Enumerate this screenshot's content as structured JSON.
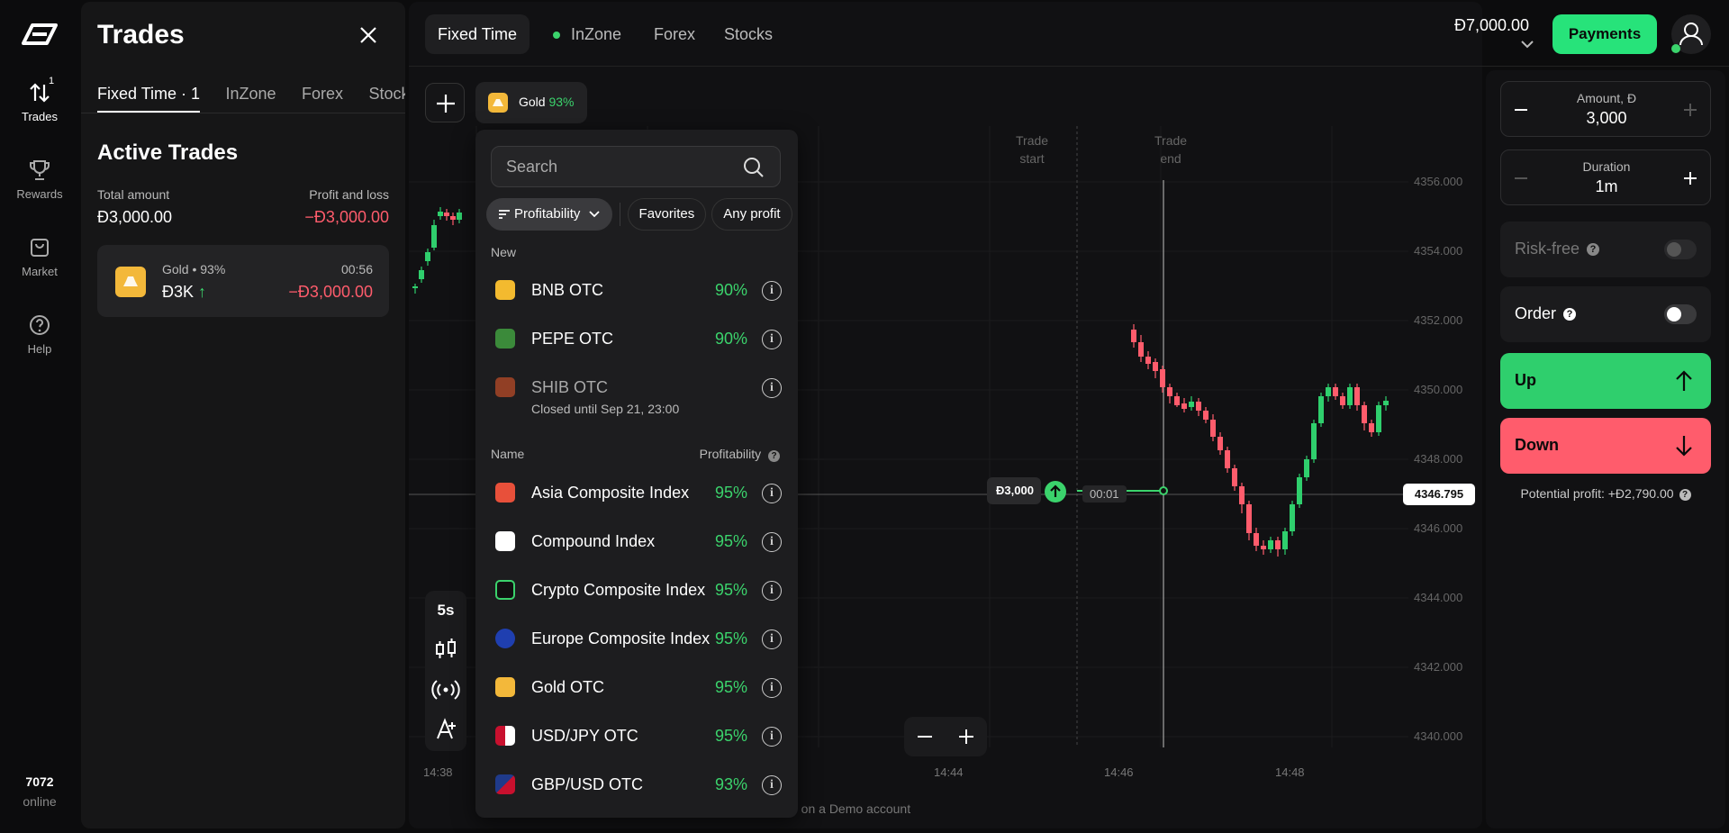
{
  "nav": {
    "items": [
      {
        "label": "Trades",
        "badge": "1"
      },
      {
        "label": "Rewards"
      },
      {
        "label": "Market"
      },
      {
        "label": "Help"
      }
    ],
    "online_count": "7072",
    "online_label": "online"
  },
  "trades_panel": {
    "title": "Trades",
    "tabs": [
      {
        "label": "Fixed Time · 1"
      },
      {
        "label": "InZone"
      },
      {
        "label": "Forex"
      },
      {
        "label": "Stocks"
      }
    ],
    "section_title": "Active Trades",
    "total_amount_label": "Total amount",
    "total_amount_value": "Đ3,000.00",
    "pl_label": "Profit and loss",
    "pl_value": "−Đ3,000.00",
    "active_trade": {
      "asset": "Gold • 93%",
      "amount": "Đ3K",
      "direction_glyph": "↑",
      "time": "00:56",
      "pl": "−Đ3,000.00"
    }
  },
  "top_bar": {
    "tabs": [
      {
        "label": "Fixed Time"
      },
      {
        "label": "InZone"
      },
      {
        "label": "Forex"
      },
      {
        "label": "Stocks"
      }
    ],
    "balance": "Đ7,000.00",
    "payments_label": "Payments"
  },
  "asset_chip": {
    "name": "Gold",
    "profit": "93%"
  },
  "chart": {
    "price_label": "4346.795",
    "trade_marker": "Đ3,000",
    "timer": "00:01",
    "trade_start_line1": "Trade",
    "trade_start_line2": "start",
    "trade_end_line1": "Trade",
    "trade_end_line2": "end",
    "x_ticks": [
      "14:38",
      "14:44",
      "14:46",
      "14:48"
    ],
    "y_ticks": [
      "4356.000",
      "4354.000",
      "4352.000",
      "4350.000",
      "4348.000",
      "4346.000",
      "4344.000",
      "4342.000",
      "4340.000"
    ],
    "timeframe": "5s",
    "demo_note": "e on a Demo account"
  },
  "dropdown": {
    "search_placeholder": "Search",
    "filters": [
      {
        "label": "Profitability"
      },
      {
        "label": "Favorites"
      },
      {
        "label": "Any profit"
      }
    ],
    "new_heading": "New",
    "new_items": [
      {
        "name": "BNB OTC",
        "profit": "90%",
        "icon_color": "#f3ba2f"
      },
      {
        "name": "PEPE OTC",
        "profit": "90%",
        "icon_color": "#3b8a3a"
      },
      {
        "name": "SHIB OTC",
        "profit": "",
        "sub": "Closed until Sep 21, 23:00",
        "icon_color": "#e0562a"
      }
    ],
    "name_heading": "Name",
    "profit_heading": "Profitability",
    "items": [
      {
        "name": "Asia Composite Index",
        "profit": "95%",
        "icon_color": "#e8503a"
      },
      {
        "name": "Compound Index",
        "profit": "95%",
        "icon_color": "#ffffff"
      },
      {
        "name": "Crypto Composite Index",
        "profit": "95%",
        "icon_color": "#1a1a1a"
      },
      {
        "name": "Europe Composite Index",
        "profit": "95%",
        "icon_color": "#1f3fb0"
      },
      {
        "name": "Gold OTC",
        "profit": "95%",
        "icon_color": "#f3b83a"
      },
      {
        "name": "USD/JPY OTC",
        "profit": "95%",
        "icon_color": "#c8102e"
      },
      {
        "name": "GBP/USD OTC",
        "profit": "93%",
        "icon_color": "#1f3a8a"
      }
    ]
  },
  "trade_panel": {
    "amount_label": "Amount, Đ",
    "amount_value": "3,000",
    "duration_label": "Duration",
    "duration_value": "1m",
    "risk_free_label": "Risk-free",
    "order_label": "Order",
    "up_label": "Up",
    "down_label": "Down",
    "potential_profit": "Potential profit: +Đ2,790.00"
  },
  "colors": {
    "accent_green": "#27e37a",
    "up_green": "#2fcf6d",
    "down_red": "#ff5c6c",
    "gold": "#f3b83a"
  }
}
